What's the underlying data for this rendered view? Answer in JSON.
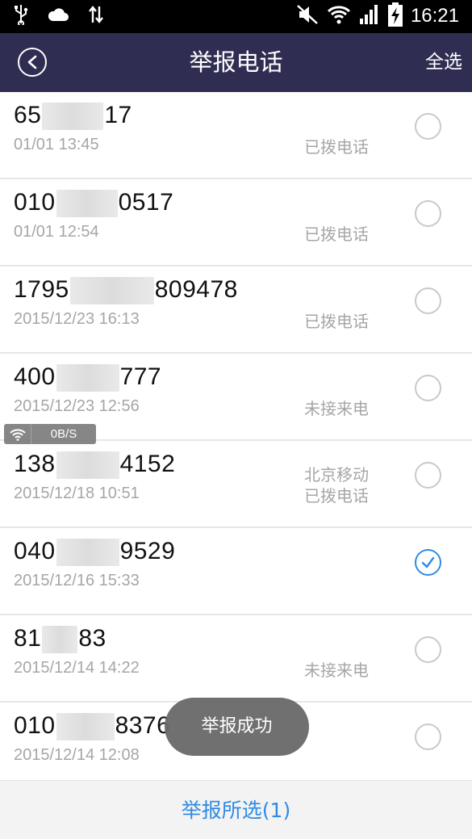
{
  "status_bar": {
    "time": "16:21",
    "left_icons": [
      "usb-icon",
      "cloud-icon",
      "data-transfer-icon"
    ],
    "right_icons": [
      "mute-icon",
      "wifi-icon",
      "signal-icon",
      "battery-charging-icon"
    ]
  },
  "header": {
    "title": "举报电话",
    "select_all_label": "全选"
  },
  "calls": [
    {
      "number_head": "65",
      "number_tail": "17",
      "datetime": "01/01 13:45",
      "location": "",
      "status": "已拨电话",
      "checked": false
    },
    {
      "number_head": "010",
      "number_tail": "0517",
      "datetime": "01/01 12:54",
      "location": "",
      "status": "已拨电话",
      "checked": false
    },
    {
      "number_head": "1795",
      "number_tail": "809478",
      "datetime": "2015/12/23 16:13",
      "location": "",
      "status": "已拨电话",
      "checked": false
    },
    {
      "number_head": "400",
      "number_tail": "777",
      "datetime": "2015/12/23 12:56",
      "location": "",
      "status": "未接来电",
      "checked": false
    },
    {
      "number_head": "138",
      "number_tail": "4152",
      "datetime": "2015/12/18 10:51",
      "location": "北京移动",
      "status": "已拨电话",
      "checked": false
    },
    {
      "number_head": "040",
      "number_tail": "9529",
      "datetime": "2015/12/16 15:33",
      "location": "",
      "status": "",
      "checked": true
    },
    {
      "number_head": "81",
      "number_tail": "83",
      "datetime": "2015/12/14 14:22",
      "location": "",
      "status": "未接来电",
      "checked": false
    },
    {
      "number_head": "010",
      "number_tail": "8376",
      "datetime": "2015/12/14 12:08",
      "location": "",
      "status": "",
      "checked": false
    }
  ],
  "network_overlay": {
    "speed": "0B/S"
  },
  "toast": {
    "message": "举报成功"
  },
  "footer": {
    "report_selected_label": "举报所选(1)"
  },
  "colors": {
    "header_bg": "#2f2d52",
    "accent": "#2f8be6",
    "secondary_text": "#a6a6a6"
  }
}
